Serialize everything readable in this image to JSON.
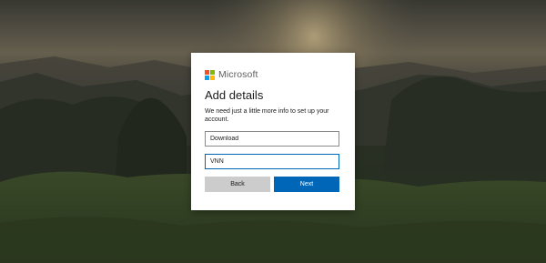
{
  "brand": {
    "name": "Microsoft",
    "logo_colors": [
      "#f25022",
      "#7fba00",
      "#00a4ef",
      "#ffb900"
    ]
  },
  "page": {
    "title": "Add details",
    "description": "We need just a little more info to set up your account."
  },
  "fields": [
    {
      "value": "Download"
    },
    {
      "value": "VNN"
    }
  ],
  "buttons": {
    "back_label": "Back",
    "next_label": "Next"
  },
  "colors": {
    "accent": "#0067b8",
    "secondary_button": "#cccccc"
  }
}
